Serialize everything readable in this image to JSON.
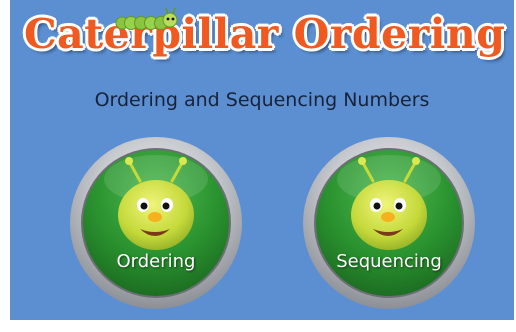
{
  "title": "Caterpillar Ordering",
  "subtitle": "Ordering and Sequencing Numbers",
  "buttons": [
    {
      "label": "Ordering"
    },
    {
      "label": "Sequencing"
    }
  ],
  "colors": {
    "background": "#5b8fd2",
    "title": "#f05a21",
    "button_green": "#2f9a35",
    "button_rim": "#c9ccd1",
    "caterpillar_face": "#c7dc3c"
  },
  "icons": [
    "caterpillar-icon",
    "caterpillar-face-icon"
  ]
}
